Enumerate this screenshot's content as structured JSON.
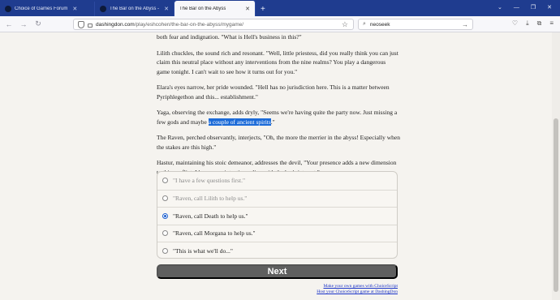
{
  "browser": {
    "tabs": [
      {
        "label": "Choice of Games Forum"
      },
      {
        "label": "The Bar on the Abyss - WIP [15..."
      },
      {
        "label": "The Bar on the Abyss"
      }
    ],
    "url_host": "dashingdon.com",
    "url_path": "/play/eshcohen/the-bar-on-the-abyss/mygame/",
    "search_value": "neoseek"
  },
  "story": {
    "p1": "both fear and indignation. \"What is Hell's business in this?\"",
    "p2": "Lilith chuckles, the sound rich and resonant. \"Well, little priestess, did you really think you can just claim this neutral place without any interventions from the nine realms? You play a dangerous game tonight. I can't wait to see how it turns out for you.\"",
    "p3": "Elara's eyes narrow, her pride wounded. \"Hell has no jurisdiction here. This is a matter between Pyriphlegethon and this... establishment.\"",
    "p4_before": "Yaga, observing the exchange, adds dryly, \"Seems we're having quite the party now. Just missing a few gods and maybe ",
    "p4_highlight": "a couple of ancient spirits",
    "p4_after": ".\"",
    "p5": "The Raven, perched observantly, interjects, \"Oh, the more the merrier in the abyss! Especially when the stakes are this high.\"",
    "p6": "Hastur, maintaining his stoic demeanor, addresses the devil, \"Your presence adds a new dimension to this conflict. I hope your intentions align with the bar's interest.\""
  },
  "choices": [
    {
      "label": "\"I have a few questions first.\"",
      "disabled": true,
      "selected": false
    },
    {
      "label": "\"Raven, call Lilith to help us.\"",
      "disabled": true,
      "selected": false
    },
    {
      "label": "\"Raven, call Death to help us.\"",
      "disabled": false,
      "selected": true
    },
    {
      "label": "\"Raven, call Morgana to help us.\"",
      "disabled": false,
      "selected": false
    },
    {
      "label": "\"This is what we'll do...\"",
      "disabled": false,
      "selected": false
    }
  ],
  "next_label": "Next",
  "footer": {
    "link1": "Make your own games with ChoiceScript",
    "link2": "Host your ChoiceScript game at DashingDon"
  },
  "colors": {
    "tabbar": "#1f3c8f",
    "highlight": "#1c6bd8",
    "next_button": "#5f5f5f",
    "link": "#1a33c8"
  }
}
